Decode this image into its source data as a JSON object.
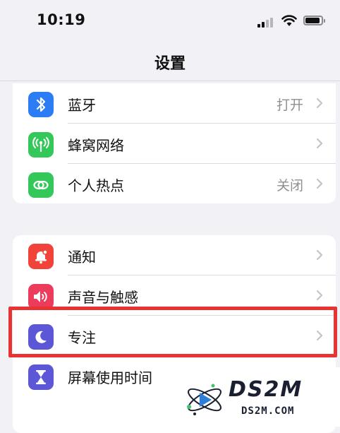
{
  "status_bar": {
    "time": "10:19"
  },
  "nav": {
    "title": "设置"
  },
  "groups": [
    {
      "rows": [
        {
          "label": "蓝牙",
          "value": "打开",
          "icon": "bluetooth-icon",
          "color": "#2c7cf6"
        },
        {
          "label": "蜂窝网络",
          "value": "",
          "icon": "antenna-icon",
          "color": "#34c759"
        },
        {
          "label": "个人热点",
          "value": "关闭",
          "icon": "chain-link-icon",
          "color": "#34c759"
        }
      ]
    },
    {
      "rows": [
        {
          "label": "通知",
          "value": "",
          "icon": "bell-icon",
          "color": "#f2433a"
        },
        {
          "label": "声音与触感",
          "value": "",
          "icon": "speaker-icon",
          "color": "#ec3b5b"
        },
        {
          "label": "专注",
          "value": "",
          "icon": "moon-icon",
          "color": "#5c57d6"
        },
        {
          "label": "屏幕使用时间",
          "value": "",
          "icon": "hourglass-icon",
          "color": "#5c57d6"
        }
      ]
    }
  ],
  "watermark": {
    "logo_text": "DS2M",
    "url": "DS2M.COM"
  },
  "colors": {
    "background": "#f2f2f6",
    "highlight": "#e73331",
    "chevron": "#c4c4c7"
  }
}
